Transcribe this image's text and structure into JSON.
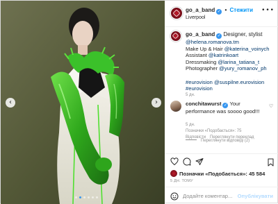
{
  "post": {
    "carousel": {
      "prev_icon": "chevron-left-icon",
      "next_icon": "chevron-right-icon",
      "slide_count": 6,
      "active_slide": 2
    },
    "header": {
      "username": "go_a_band",
      "verified_mark": "✓",
      "separator": "•",
      "follow_label": "Стежити",
      "location": "Liverpool",
      "more_icon": "•••"
    },
    "caption": {
      "username": "go_a_band",
      "lines": [
        {
          "text": "Designer, stylist",
          "is_link": false
        },
        {
          "text": "@helena.romanova.tm",
          "is_link": true
        },
        {
          "text": "Make Up & Hair ",
          "link": "@katerina_voinych"
        },
        {
          "text": "Assistant ",
          "link": "@katrinkoart"
        },
        {
          "text": "Dressmaking ",
          "link": "@larina_tatiana_t"
        },
        {
          "text": "Photographer ",
          "link": "@yury_romanov_ph"
        }
      ],
      "hashtags_line1": "#eurovision @suspilne.eurovision",
      "hashtags_line2": "#eurovision",
      "time": "5 дн."
    },
    "comment": {
      "username": "conchitawurst",
      "text": "Your performance was soooo good!!!",
      "time": "5 дн.",
      "likes_label": "Позначки «Подобається»: 75",
      "reply_label": "Відповісти",
      "translate_label": "Переглянути переклад",
      "view_replies_label": "Переглянути відповіді (2)"
    },
    "actions": {
      "likes_label": "Позначки «Подобається»: ",
      "likes_count": "45 584",
      "posted_ago": "5 ДН. ТОМУ"
    },
    "add_comment": {
      "placeholder": "Додайте коментар...",
      "publish_label": "Опублікувати"
    },
    "colors": {
      "accent": "#0095f6",
      "link": "#00376b",
      "muted": "#8e8e8e",
      "glove_green": "#3dbb2a"
    }
  }
}
